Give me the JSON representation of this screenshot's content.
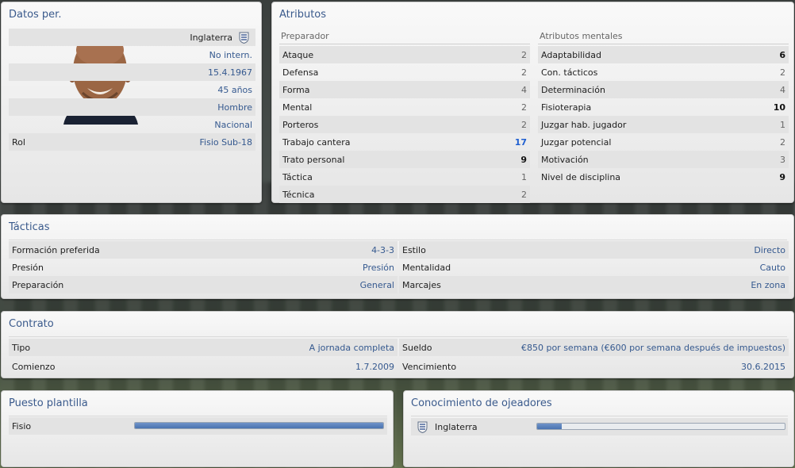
{
  "personal": {
    "title": "Datos per.",
    "nation": "Inglaterra",
    "nation_icon": "england-crest-icon",
    "international": "No intern.",
    "birth_date": "15.4.1967",
    "age": "45 años",
    "gender": "Hombre",
    "status": "Nacional",
    "role_label": "Rol",
    "role_value": "Fisio Sub-18"
  },
  "attributes": {
    "title": "Atributos",
    "coach_header": "Preparador",
    "mental_header": "Atributos mentales",
    "coach": [
      {
        "label": "Ataque",
        "value": "2"
      },
      {
        "label": "Defensa",
        "value": "2"
      },
      {
        "label": "Forma",
        "value": "4"
      },
      {
        "label": "Mental",
        "value": "2"
      },
      {
        "label": "Porteros",
        "value": "2"
      },
      {
        "label": "Trabajo cantera",
        "value": "17"
      },
      {
        "label": "Trato personal",
        "value": "9"
      },
      {
        "label": "Táctica",
        "value": "1"
      },
      {
        "label": "Técnica",
        "value": "2"
      }
    ],
    "mental": [
      {
        "label": "Adaptabilidad",
        "value": "6"
      },
      {
        "label": "Con. tácticos",
        "value": "2"
      },
      {
        "label": "Determinación",
        "value": "4"
      },
      {
        "label": "Fisioterapia",
        "value": "10"
      },
      {
        "label": "Juzgar hab. jugador",
        "value": "1"
      },
      {
        "label": "Juzgar potencial",
        "value": "2"
      },
      {
        "label": "Motivación",
        "value": "3"
      },
      {
        "label": "Nivel de disciplina",
        "value": "9"
      }
    ]
  },
  "tactics": {
    "title": "Tácticas",
    "left": [
      {
        "label": "Formación preferida",
        "value": "4-3-3"
      },
      {
        "label": "Presión",
        "value": "Presión"
      },
      {
        "label": "Preparación",
        "value": "General"
      }
    ],
    "right": [
      {
        "label": "Estilo",
        "value": "Directo"
      },
      {
        "label": "Mentalidad",
        "value": "Cauto"
      },
      {
        "label": "Marcajes",
        "value": "En zona"
      }
    ]
  },
  "contract": {
    "title": "Contrato",
    "type_label": "Tipo",
    "type_value": "A jornada completa",
    "start_label": "Comienzo",
    "start_value": "1.7.2009",
    "wage_label": "Sueldo",
    "wage_value": "€850 por semana (€600 por semana después de impuestos)",
    "expiry_label": "Vencimiento",
    "expiry_value": "30.6.2015"
  },
  "squad_position": {
    "title": "Puesto plantilla",
    "label": "Fisio",
    "level": 1.0
  },
  "scout_knowledge": {
    "title": "Conocimiento de ojeadores",
    "label": "Inglaterra",
    "level": 0.1
  },
  "colors": {
    "accent": "#3a5a8c",
    "highlight": "#1f5fd1",
    "bar": "#4a74b0"
  }
}
